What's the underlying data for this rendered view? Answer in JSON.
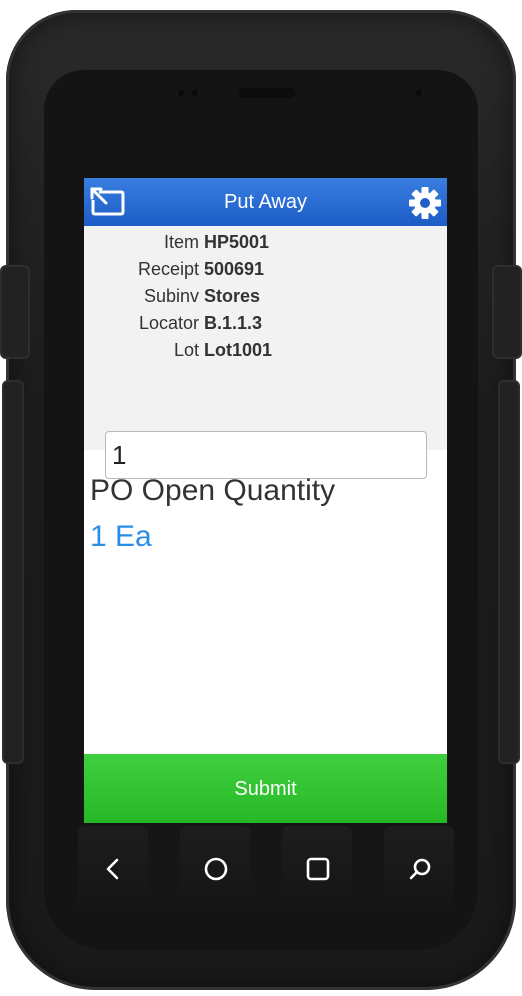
{
  "app": {
    "title": "Put Away"
  },
  "icons": {
    "back": "back-icon",
    "settings": "gear-icon",
    "nav_back": "chevron-left-icon",
    "nav_home": "circle-icon",
    "nav_recents": "square-icon",
    "nav_search": "search-icon"
  },
  "info": [
    {
      "label": "Item",
      "value": "HP5001"
    },
    {
      "label": "Receipt",
      "value": "500691"
    },
    {
      "label": "Subinv",
      "value": "Stores"
    },
    {
      "label": "Locator",
      "value": "B.1.1.3"
    },
    {
      "label": "Lot",
      "value": "Lot1001"
    }
  ],
  "quantity_input": {
    "value": "1"
  },
  "prompt": {
    "label": "PO Open Quantity",
    "value": "1 Ea"
  },
  "submit_label": "Submit",
  "colors": {
    "titlebar": "#1c5cc6",
    "submit": "#2dbf2d",
    "prompt_value": "#2a8ee8"
  }
}
